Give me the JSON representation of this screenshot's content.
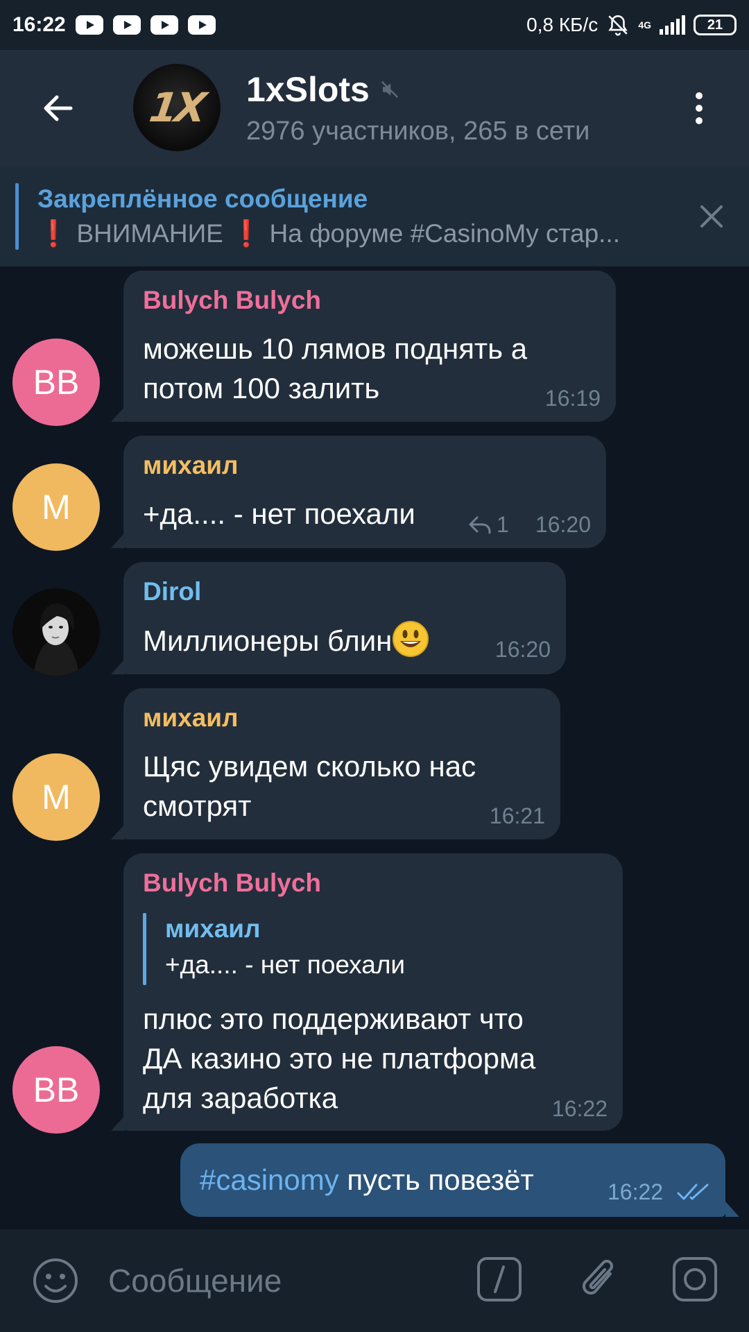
{
  "status_bar": {
    "time": "16:22",
    "speed": "0,8 КБ/с",
    "network": "4G",
    "battery": "21"
  },
  "header": {
    "title": "1xSlots",
    "subtitle": "2976 участников, 265 в сети",
    "logo_text": "1X"
  },
  "pinned": {
    "title": "Закреплённое сообщение",
    "mark": "❗",
    "text_a": "ВНИМАНИЕ",
    "text_b": "На форуме #CasinoMy стар..."
  },
  "messages": [
    {
      "avatar": "BB",
      "sender": "Bulych Bulych",
      "line1": "можешь 10 лямов поднять а",
      "line2": "потом 100 залить",
      "time": "16:19"
    },
    {
      "avatar": "M",
      "sender": "михаил",
      "line1": "+да.... - нет поехали",
      "reply_count": "1",
      "time": "16:20"
    },
    {
      "sender": "Dirol",
      "line1": "Миллионеры блин",
      "time": "16:20"
    },
    {
      "avatar": "M",
      "sender": "михаил",
      "line1": "Щяс увидем сколько нас",
      "line2": "смотрят",
      "time": "16:21"
    },
    {
      "avatar": "BB",
      "sender": "Bulych Bulych",
      "reply_name": "михаил",
      "reply_text": "+да.... - нет поехали",
      "line1": "плюс это поддерживают что",
      "line2": "ДА казино это не платформа",
      "line3": "для заработка",
      "time": "16:22"
    }
  ],
  "outgoing": {
    "hashtag": "#casinomy",
    "text": " пусть повезёт",
    "time": "16:22"
  },
  "input": {
    "placeholder": "Сообщение"
  },
  "colors": {
    "background": "#0e1621",
    "header": "#232e3c",
    "bubble_in": "#222e3b",
    "bubble_out": "#2b5278",
    "accent_blue": "#5aa2dc",
    "avatar_pink": "#ec6b95",
    "avatar_yellow": "#f0b95f"
  }
}
